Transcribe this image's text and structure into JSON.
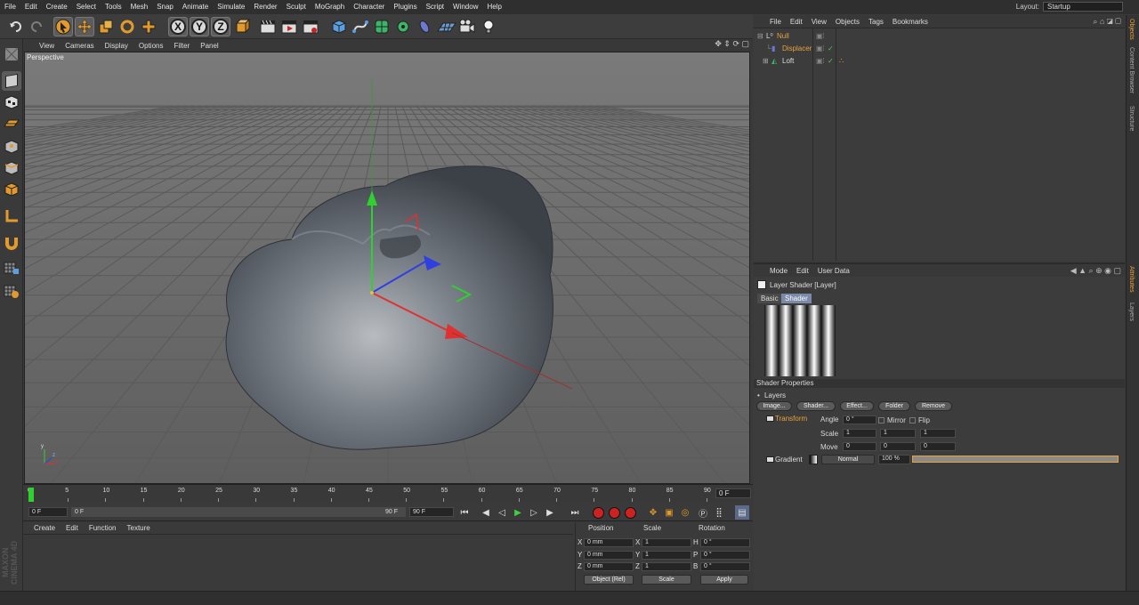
{
  "menubar": {
    "items": [
      "File",
      "Edit",
      "Create",
      "Select",
      "Tools",
      "Mesh",
      "Snap",
      "Animate",
      "Simulate",
      "Render",
      "Sculpt",
      "MoGraph",
      "Character",
      "Plugins",
      "Script",
      "Window",
      "Help"
    ],
    "layout_label": "Layout:",
    "layout_value": "Startup"
  },
  "toolbar": {
    "axis_x": "X",
    "axis_y": "Y",
    "axis_z": "Z"
  },
  "viewport": {
    "menu": [
      "View",
      "Cameras",
      "Display",
      "Options",
      "Filter",
      "Panel"
    ],
    "label": "Perspective",
    "mini_axis": {
      "y": "y",
      "x": "x",
      "z": "z"
    }
  },
  "timeline": {
    "ticks": [
      "0",
      "5",
      "10",
      "15",
      "20",
      "25",
      "30",
      "35",
      "40",
      "45",
      "50",
      "55",
      "60",
      "65",
      "70",
      "75",
      "80",
      "85",
      "90"
    ],
    "current_frame": "0 F"
  },
  "playbar": {
    "start": "0 F",
    "range_start": "0 F",
    "range_end": "90 F",
    "end": "90 F"
  },
  "material_manager": {
    "menu": [
      "Create",
      "Edit",
      "Function",
      "Texture"
    ],
    "brand": "MAXON CINEMA 4D"
  },
  "coordinates": {
    "headers": {
      "position": "Position",
      "scale": "Scale",
      "rotation": "Rotation"
    },
    "rows": [
      {
        "axis": "X",
        "pos": "0 mm",
        "saxis": "X",
        "scale": "1",
        "raxis": "H",
        "rot": "0 °"
      },
      {
        "axis": "Y",
        "pos": "0 mm",
        "saxis": "Y",
        "scale": "1",
        "raxis": "P",
        "rot": "0 °"
      },
      {
        "axis": "Z",
        "pos": "0 mm",
        "saxis": "Z",
        "scale": "1",
        "raxis": "B",
        "rot": "0 °"
      }
    ],
    "mode": "Object (Rel)",
    "scale_mode": "Scale",
    "apply": "Apply"
  },
  "object_manager": {
    "menu": [
      "File",
      "Edit",
      "View",
      "Objects",
      "Tags",
      "Bookmarks"
    ],
    "objects": [
      {
        "name": "Null",
        "color": "#e8a33a"
      },
      {
        "name": "Displacer",
        "color": "#e8a33a"
      },
      {
        "name": "Loft",
        "color": "#dcdcdc"
      }
    ]
  },
  "attribute_manager": {
    "menu": [
      "Mode",
      "Edit",
      "User Data"
    ],
    "title": "Layer Shader [Layer]",
    "tabs": [
      "Basic",
      "Shader"
    ],
    "section": "Shader Properties",
    "layers_label": "Layers",
    "buttons": [
      "Image...",
      "Shader...",
      "Effect...",
      "Folder",
      "Remove"
    ],
    "transform": {
      "name": "Transform",
      "angle_label": "Angle",
      "angle": "0 °",
      "mirror": "Mirror",
      "flip": "Flip",
      "scale_label": "Scale",
      "scale": [
        "1",
        "1",
        "1"
      ],
      "move_label": "Move",
      "move": [
        "0",
        "0",
        "0"
      ]
    },
    "gradient": {
      "name": "Gradient",
      "blend": "Normal",
      "opacity": "100 %"
    }
  },
  "side_tabs": [
    "Objects",
    "Content Browser",
    "Structure"
  ],
  "side_tabs2": [
    "Attributes",
    "Layers"
  ],
  "colors": {
    "accent": "#e8a33a",
    "selected": "#7a8aa8"
  }
}
